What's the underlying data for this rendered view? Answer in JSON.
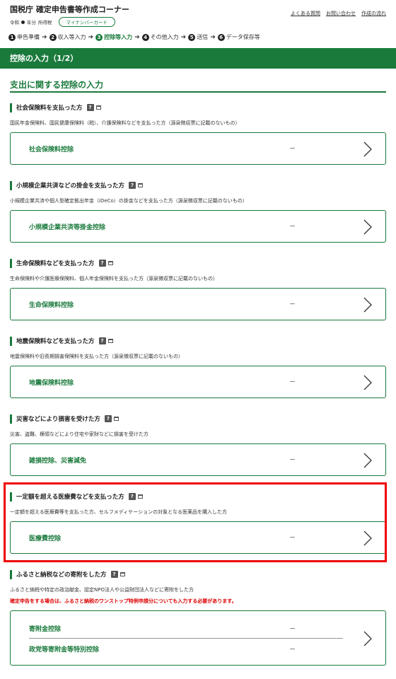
{
  "header": {
    "title": "国税庁 確定申告書等作成コーナー",
    "era": "令和",
    "year_label": "年分",
    "tax_type": "所得税",
    "mynumber_label": "マイナンバーカード",
    "links": [
      "よくある質問",
      "お問い合わせ",
      "作成の流れ"
    ]
  },
  "steps": [
    {
      "num": "1",
      "label": "申告準備"
    },
    {
      "num": "2",
      "label": "収入等入力"
    },
    {
      "num": "3",
      "label": "控除等入力"
    },
    {
      "num": "4",
      "label": "その他入力"
    },
    {
      "num": "5",
      "label": "送信"
    },
    {
      "num": "6",
      "label": "データ保存等"
    }
  ],
  "page_bar": "控除の入力（1/2）",
  "section_title": "支出に関する控除の入力",
  "help_glyph": "?",
  "categories": [
    {
      "title": "社会保険料を支払った方",
      "desc": "国民年金保険料、国民健康保険料（税）、介護保険料などを支払った方（源泉徴収票に記載のないもの）",
      "card_label": "社会保険料控除",
      "card_value": "－"
    },
    {
      "title": "小規模企業共済などの掛金を支払った方",
      "desc": "小規模企業共済や個人型確定拠出年金（iDeCo）の掛金などを支払った方（源泉徴収票に記載のないもの）",
      "card_label": "小規模企業共済等掛金控除",
      "card_value": "－"
    },
    {
      "title": "生命保険料などを支払った方",
      "desc": "生命保険料や介護医療保険料、個人年金保険料を支払った方（源泉徴収票に記載のないもの）",
      "card_label": "生命保険料控除",
      "card_value": "－"
    },
    {
      "title": "地震保険料などを支払った方",
      "desc": "地震保険料や旧長期損害保険料を支払った方（源泉徴収票に記載のないもの）",
      "card_label": "地震保険料控除",
      "card_value": "－"
    },
    {
      "title": "災害などにより損害を受けた方",
      "desc": "災害、盗難、横領などにより住宅や家財などに損害を受けた方",
      "card_label": "雑損控除、災害減免",
      "card_value": "－"
    },
    {
      "title": "一定額を超える医療費などを支払った方",
      "desc": "一定額を超える医療費等を支払った方、セルフメディケーションの対象となる医薬品を購入した方",
      "card_label": "医療費控除",
      "card_value": "－"
    }
  ],
  "donation": {
    "title": "ふるさと納税などの寄附をした方",
    "desc": "ふるさと納税や特定の政治献金、認定NPO法人や公益財団法人などに寄附をした方",
    "warning": "確定申告をする場合は、ふるさと納税のワンストップ特例申請分についても入力する必要があります。",
    "row1_label": "寄附金控除",
    "row1_value": "－",
    "row2_label": "政党等寄附金等特別控除",
    "row2_value": "－"
  }
}
